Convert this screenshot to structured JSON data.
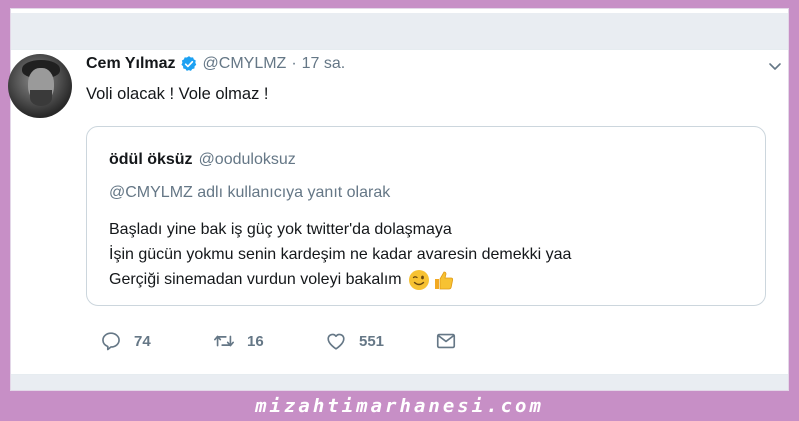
{
  "tweet": {
    "author_name": "Cem Yılmaz",
    "handle": "@CMYLMZ",
    "separator": "·",
    "time": "17 sa.",
    "text": "Voli olacak ! Vole olmaz !"
  },
  "quoted": {
    "author_name": "ödül öksüz",
    "handle": "@ooduloksuz",
    "reply_context": "@CMYLMZ adlı kullanıcıya yanıt olarak",
    "lines": [
      "Başladı yine bak iş güç yok twitter'da dolaşmaya",
      "İşin gücün yokmu senin kardeşim ne kadar avaresin demekki yaa",
      "Gerçiği sinemadan vurdun voleyi bakalım"
    ]
  },
  "actions": {
    "replies": "74",
    "retweets": "16",
    "likes": "551"
  },
  "icons": [
    "verified-badge-icon",
    "chevron-down-icon",
    "wink-emoji-icon",
    "thumbs-up-emoji-icon",
    "reply-icon",
    "retweet-icon",
    "like-icon",
    "message-icon"
  ],
  "colors": {
    "accent": "#1da1f2",
    "frame_border": "#c78fc6",
    "text_primary": "#14171a",
    "text_secondary": "#657786"
  },
  "watermark": "mizahtimarhanesi.com"
}
